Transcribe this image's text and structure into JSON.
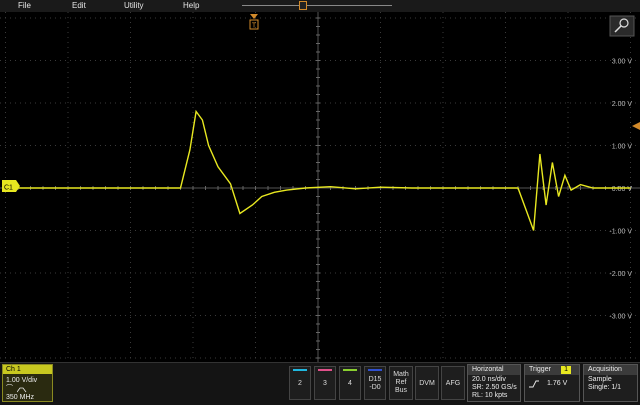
{
  "menu": {
    "file": "File",
    "edit": "Edit",
    "utility": "Utility",
    "help": "Help"
  },
  "trigger_marker_label": "T",
  "ch1_marker_label": "C1",
  "y_ticks": [
    "3.00 V",
    "2.00 V",
    "1.00 V",
    "0.00 V",
    "-1.00 V",
    "-2.00 V",
    "-3.00 V"
  ],
  "ch1": {
    "title": "Ch 1",
    "scale": "1.00 V/div",
    "bandwidth": "350 MHz"
  },
  "channels": [
    {
      "label": "2",
      "color": "#20b8e0"
    },
    {
      "label": "3",
      "color": "#e0508a"
    },
    {
      "label": "4",
      "color": "#8ad030"
    }
  ],
  "digital": {
    "line1": "D15",
    "line2": "-D0",
    "color": "#3050d0"
  },
  "math": {
    "line1": "Math",
    "line2": "Ref",
    "line3": "Bus"
  },
  "dvm": "DVM",
  "afg": "AFG",
  "horizontal": {
    "title": "Horizontal",
    "scale": "20.0 ns/div",
    "sample_rate": "SR: 2.50 GS/s",
    "record_length": "RL: 10 kpts"
  },
  "trigger": {
    "title": "Trigger",
    "source": "1",
    "level": "1.76 V"
  },
  "acquisition": {
    "title": "Acquisition",
    "mode": "Sample",
    "state": "Single: 1/1"
  },
  "colors": {
    "trace": "#e8e820",
    "grid": "#3a3a3a",
    "accent": "#d28a2a"
  },
  "chart_data": {
    "type": "line",
    "ylim": [
      -4,
      4
    ],
    "xlim": [
      -5,
      5
    ],
    "x": [
      -5,
      -2.2,
      -2.05,
      -1.95,
      -1.85,
      -1.75,
      -1.6,
      -1.4,
      -1.25,
      -1.05,
      -0.9,
      -0.7,
      -0.5,
      -0.2,
      0.2,
      0.6,
      1.0,
      1.5,
      2.4,
      3.2,
      3.35,
      3.45,
      3.55,
      3.65,
      3.75,
      3.85,
      3.95,
      4.05,
      4.2,
      4.4,
      5
    ],
    "series": [
      {
        "values": [
          0,
          0,
          0.9,
          1.8,
          1.6,
          1.0,
          0.5,
          0.1,
          -0.6,
          -0.4,
          -0.2,
          -0.1,
          -0.05,
          0,
          0.03,
          -0.02,
          0.02,
          0,
          0,
          0,
          -0.6,
          -1.0,
          0.8,
          -0.4,
          0.6,
          -0.2,
          0.3,
          -0.05,
          0.08,
          0,
          0
        ]
      }
    ]
  }
}
